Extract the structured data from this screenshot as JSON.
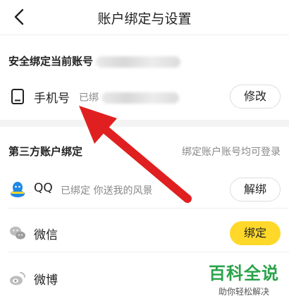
{
  "header": {
    "title": "账户绑定与设置"
  },
  "security": {
    "title": "安全绑定当前账号",
    "phone": {
      "label": "手机号",
      "status": "已绑",
      "button": "修改"
    }
  },
  "third_party": {
    "title": "第三方账户绑定",
    "hint": "绑定账户账号均可登录",
    "items": [
      {
        "name": "QQ",
        "status": "已绑定 你送我的风景",
        "button": "解绑"
      },
      {
        "name": "微信",
        "status": "",
        "button": "绑定"
      },
      {
        "name": "微博",
        "status": "",
        "button": ""
      }
    ]
  },
  "watermark": {
    "main": "百科全说",
    "sub": "助你轻松解决"
  },
  "colors": {
    "accent": "#ffd82a",
    "arrow": "#e02020",
    "qq": "#1e88e5",
    "watermark": "#2aa34a"
  }
}
